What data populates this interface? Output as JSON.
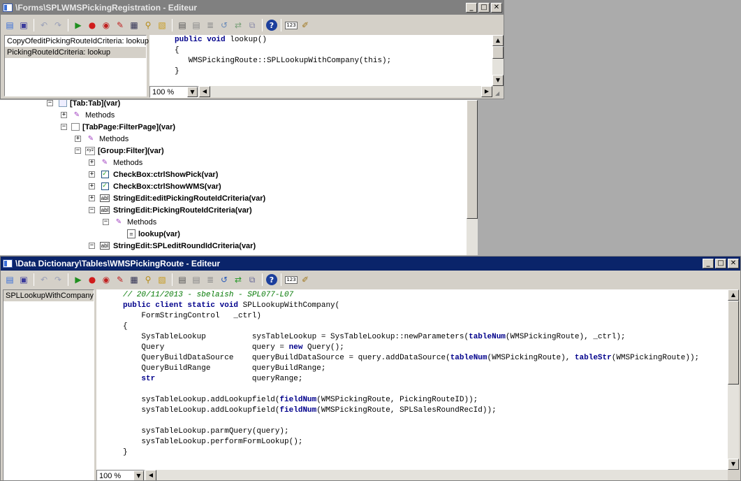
{
  "colors": {
    "desktop": "#ababab",
    "active_title": "#0a246a",
    "inactive_title": "#808080",
    "keyword": "#00008b",
    "comment": "#007700",
    "toolbar": "#d4d0c8"
  },
  "window_top": {
    "title": "\\Forms\\SPLWMSPickingRegistration - Editeur",
    "methods": [
      "CopyOfeditPickingRouteIdCriteria: lookup",
      "PickingRouteIdCriteria: lookup"
    ],
    "code": {
      "l1_kw1": "public",
      "l1_kw2": "void",
      "l1_rest": " lookup()",
      "l2": "{",
      "l3": "   WMSPickingRoute::SPLLookupWithCompany(this);",
      "l4": "}"
    },
    "zoom": "100 %"
  },
  "window_bottom": {
    "title": "\\Data Dictionary\\Tables\\WMSPickingRoute - Editeur",
    "methods": [
      "SPLLookupWithCompany"
    ],
    "zoom": "100 %",
    "code": {
      "comment": "// 20/11/2013 - sbelaish - SPL077-L07",
      "sig_kw": "public client static void",
      "sig_rest": " SPLLookupWithCompany(",
      "param": "    FormStringControl   _ctrl)",
      "open": "{",
      "d1a": "    SysTableLookup          sysTableLookup = SysTableLookup::newParameters(",
      "d1kw": "tableNum",
      "d1b": "(WMSPickingRoute), _ctrl);",
      "d2a": "    Query                   query = ",
      "d2kw": "new",
      "d2b": " Query();",
      "d3a": "    QueryBuildDataSource    queryBuildDataSource = query.addDataSource(",
      "d3kw1": "tableNum",
      "d3b": "(WMSPickingRoute), ",
      "d3kw2": "tableStr",
      "d3c": "(WMSPickingRoute));",
      "d4": "    QueryBuildRange         queryBuildRange;",
      "d5ind": "    ",
      "d5kw": "str",
      "d5b": "                     queryRange;",
      "a1a": "    sysTableLookup.addLookupfield(",
      "a1kw": "fieldNum",
      "a1b": "(WMSPickingRoute, PickingRouteID));",
      "a2a": "    sysTableLookup.addLookupfield(",
      "a2kw": "fieldNum",
      "a2b": "(WMSPickingRoute, SPLSalesRoundRecId));",
      "p1": "    sysTableLookup.parmQuery(query);",
      "p2": "    sysTableLookup.performFormLookup();",
      "close": "}"
    }
  },
  "tree": {
    "n1": "[Tab:Tab](var)",
    "n2": "Methods",
    "n3": "[TabPage:FilterPage](var)",
    "n4": "Methods",
    "n5": "[Group:Filter](var)",
    "n6": "Methods",
    "n7": "CheckBox:ctrlShowPick(var)",
    "n8": "CheckBox:ctrlShowWMS(var)",
    "n9": "StringEdit:editPickingRouteIdCriteria(var)",
    "n10": "StringEdit:PickingRouteIdCriteria(var)",
    "n11": "Methods",
    "n12": "lookup(var)",
    "n13": "StringEdit:SPLeditRoundIdCriteria(var)"
  },
  "icons": [
    "new-icon",
    "save-icon",
    "undo-icon",
    "redo-icon",
    "run-icon",
    "breakpoint-icon",
    "remove-breakpoints-icon",
    "clear-breakpoints-icon",
    "compile-icon",
    "lookup-properties-icon",
    "script-icon",
    "comment-icon",
    "uncomment-icon",
    "indent-icon",
    "find-icon",
    "goto-icon",
    "help-icon",
    "line-numbers-icon",
    "edit-icon"
  ]
}
